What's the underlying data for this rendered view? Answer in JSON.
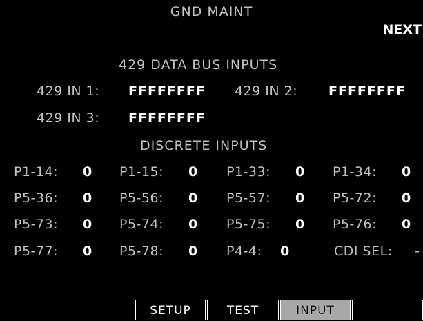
{
  "title": "GND MAINT",
  "next_label": "NEXT",
  "bus": {
    "heading": "429 DATA BUS INPUTS",
    "in1_label": "429 IN 1:",
    "in1_value": "FFFFFFFF",
    "in2_label": "429 IN 2:",
    "in2_value": "FFFFFFFF",
    "in3_label": "429 IN 3:",
    "in3_value": "FFFFFFFF"
  },
  "discrete": {
    "heading": "DISCRETE INPUTS",
    "rows": [
      [
        {
          "label": "P1-14:",
          "value": "0"
        },
        {
          "label": "P1-15:",
          "value": "0"
        },
        {
          "label": "P1-33:",
          "value": "0"
        },
        {
          "label": "P1-34:",
          "value": "0"
        }
      ],
      [
        {
          "label": "P5-36:",
          "value": "0"
        },
        {
          "label": "P5-56:",
          "value": "0"
        },
        {
          "label": "P5-57:",
          "value": "0"
        },
        {
          "label": "P5-72:",
          "value": "0"
        }
      ],
      [
        {
          "label": "P5-73:",
          "value": "0"
        },
        {
          "label": "P5-74:",
          "value": "0"
        },
        {
          "label": "P5-75:",
          "value": "0"
        },
        {
          "label": "P5-76:",
          "value": "0"
        }
      ],
      [
        {
          "label": "P5-77:",
          "value": "0"
        },
        {
          "label": "P5-78:",
          "value": "0"
        },
        {
          "label": "P4-4:",
          "value": "0"
        },
        {
          "label": "CDI SEL:",
          "value": "-"
        }
      ]
    ]
  },
  "tabs": [
    {
      "label": "SETUP",
      "active": false
    },
    {
      "label": "TEST",
      "active": false
    },
    {
      "label": "INPUT",
      "active": true
    }
  ]
}
